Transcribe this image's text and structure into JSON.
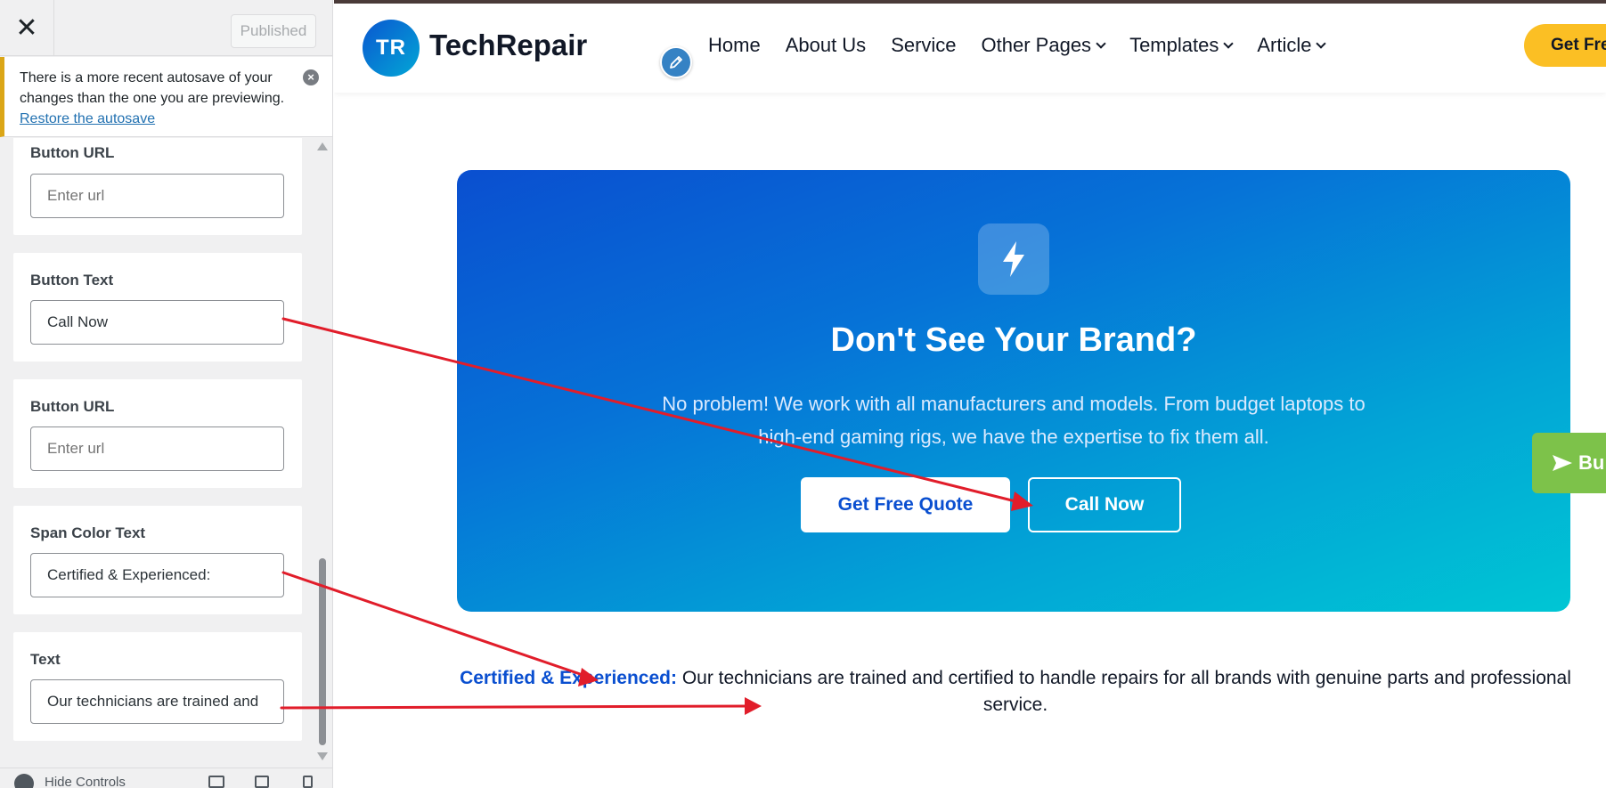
{
  "sidebar": {
    "close_icon": "close-icon",
    "published_label": "Published",
    "notice": {
      "message": "There is a more recent autosave of your changes than the one you are previewing.",
      "link": "Restore the autosave",
      "dismiss_icon": "dismiss-icon"
    },
    "controls": [
      {
        "label": "Button URL",
        "value": "",
        "placeholder": "Enter url"
      },
      {
        "label": "Button Text",
        "value": "Call Now",
        "placeholder": ""
      },
      {
        "label": "Button URL",
        "value": "",
        "placeholder": "Enter url"
      },
      {
        "label": "Span Color Text",
        "value": "Certified & Experienced:",
        "placeholder": ""
      },
      {
        "label": "Text",
        "value": "Our technicians are trained and",
        "placeholder": ""
      }
    ],
    "footer": {
      "label": "Hide Controls"
    }
  },
  "site": {
    "logo_initials": "TR",
    "logo_name": "TechRepair",
    "nav": [
      {
        "label": "Home",
        "dropdown": false
      },
      {
        "label": "About Us",
        "dropdown": false
      },
      {
        "label": "Service",
        "dropdown": false
      },
      {
        "label": "Other Pages",
        "dropdown": true
      },
      {
        "label": "Templates",
        "dropdown": true
      },
      {
        "label": "Article",
        "dropdown": true
      }
    ],
    "header_cta": "Get Fre",
    "cta": {
      "icon": "lightning-icon",
      "title": "Don't See Your Brand?",
      "description": "No problem! We work with all manufacturers and models. From budget laptops to high-end gaming rigs, we have the expertise to fix them all.",
      "primary_button": "Get Free Quote",
      "secondary_button": "Call Now"
    },
    "floating_button": "Bu",
    "certified": {
      "span_text": "Certified & Experienced:",
      "text": " Our technicians are trained and certified to handle repairs for all brands with genuine parts and professional service."
    }
  },
  "colors": {
    "notice_border": "#dba617",
    "brand_blue": "#0a4fd0",
    "brand_cyan": "#00c6d4",
    "header_cta": "#fbbf24",
    "float_green": "#7dc24a",
    "annotation_red": "#e11d2a"
  }
}
